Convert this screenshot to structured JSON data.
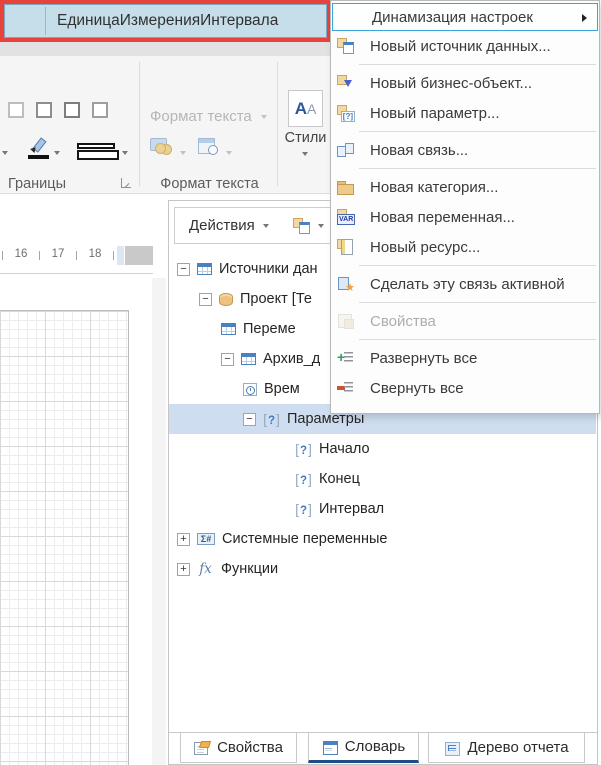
{
  "field": {
    "value": "ЕдиницаИзмеренияИнтервала",
    "border_color": "#e8423d",
    "fill_color": "#c6dee9"
  },
  "ribbon": {
    "borders_group_label": "Границы",
    "text_format_group_label": "Формат текста",
    "text_format_button_label": "Формат текста",
    "styles_button_label": "Стили",
    "icons": [
      "border-box-icon",
      "border-color-pen-icon",
      "border-style-double-line-icon",
      "currency-format-icon",
      "date-format-icon",
      "styles-aa-icon",
      "dialog-launcher-icon"
    ]
  },
  "ruler": {
    "numbers": [
      "16",
      "17",
      "18"
    ]
  },
  "dictionary_panel": {
    "toolbar": {
      "actions_button_label": "Действия",
      "new_item_icon": "create-new-item-icon"
    },
    "tree": [
      {
        "label": "Источники дан",
        "icon": "data-sources-icon",
        "level": 0,
        "state": "expanded"
      },
      {
        "label": "Проект [Те",
        "icon": "database-icon",
        "level": 1,
        "state": "expanded"
      },
      {
        "label": "Переме",
        "icon": "data-table-icon",
        "level": 2
      },
      {
        "label": "Архив_д",
        "icon": "data-table-icon",
        "level": 2,
        "state": "expanded"
      },
      {
        "label": "Врем",
        "icon": "time-column-icon",
        "level": 3
      },
      {
        "label": "Параметры",
        "icon": "parameter-icon",
        "level": 3,
        "state": "expanded",
        "selected": true
      },
      {
        "label": "Начало",
        "icon": "parameter-icon",
        "level": 4
      },
      {
        "label": "Конец",
        "icon": "parameter-icon",
        "level": 4
      },
      {
        "label": "Интервал",
        "icon": "parameter-icon",
        "level": 4
      },
      {
        "label": "Системные переменные",
        "icon": "system-variables-icon",
        "level": 0,
        "state": "collapsed"
      },
      {
        "label": "Функции",
        "icon": "functions-icon",
        "level": 0,
        "state": "collapsed"
      }
    ],
    "tabs": [
      {
        "label": "Свойства",
        "icon": "properties-tab-icon",
        "active": false
      },
      {
        "label": "Словарь",
        "icon": "dictionary-tab-icon",
        "active": true
      },
      {
        "label": "Дерево отчета",
        "icon": "report-tree-tab-icon",
        "active": false
      }
    ]
  },
  "context_menu": {
    "items": [
      {
        "label": "Динамизация настроек",
        "has_submenu": true,
        "highlighted": true
      },
      {
        "label": "Новый источник данных...",
        "icon": "new-data-source-icon"
      },
      {
        "label": "Новый бизнес-объект...",
        "icon": "new-business-object-icon"
      },
      {
        "label": "Новый параметр...",
        "icon": "new-parameter-icon"
      },
      {
        "label": "Новая связь...",
        "icon": "new-relation-icon"
      },
      {
        "label": "Новая категория...",
        "icon": "new-category-icon"
      },
      {
        "label": "Новая переменная...",
        "icon": "new-variable-icon"
      },
      {
        "label": "Новый ресурс...",
        "icon": "new-resource-icon"
      },
      {
        "label": "Сделать эту связь активной",
        "icon": "make-relation-active-icon"
      },
      {
        "label": "Свойства",
        "icon": "properties-icon",
        "disabled": true
      },
      {
        "label": "Развернуть все",
        "icon": "expand-all-icon"
      },
      {
        "label": "Свернуть все",
        "icon": "collapse-all-icon"
      }
    ]
  },
  "colors": {
    "highlight_red": "#e8423d",
    "selection_blue": "#cfddf0",
    "menu_highlight_border": "#38a3dd",
    "active_tab_underline": "#1d4e89"
  }
}
